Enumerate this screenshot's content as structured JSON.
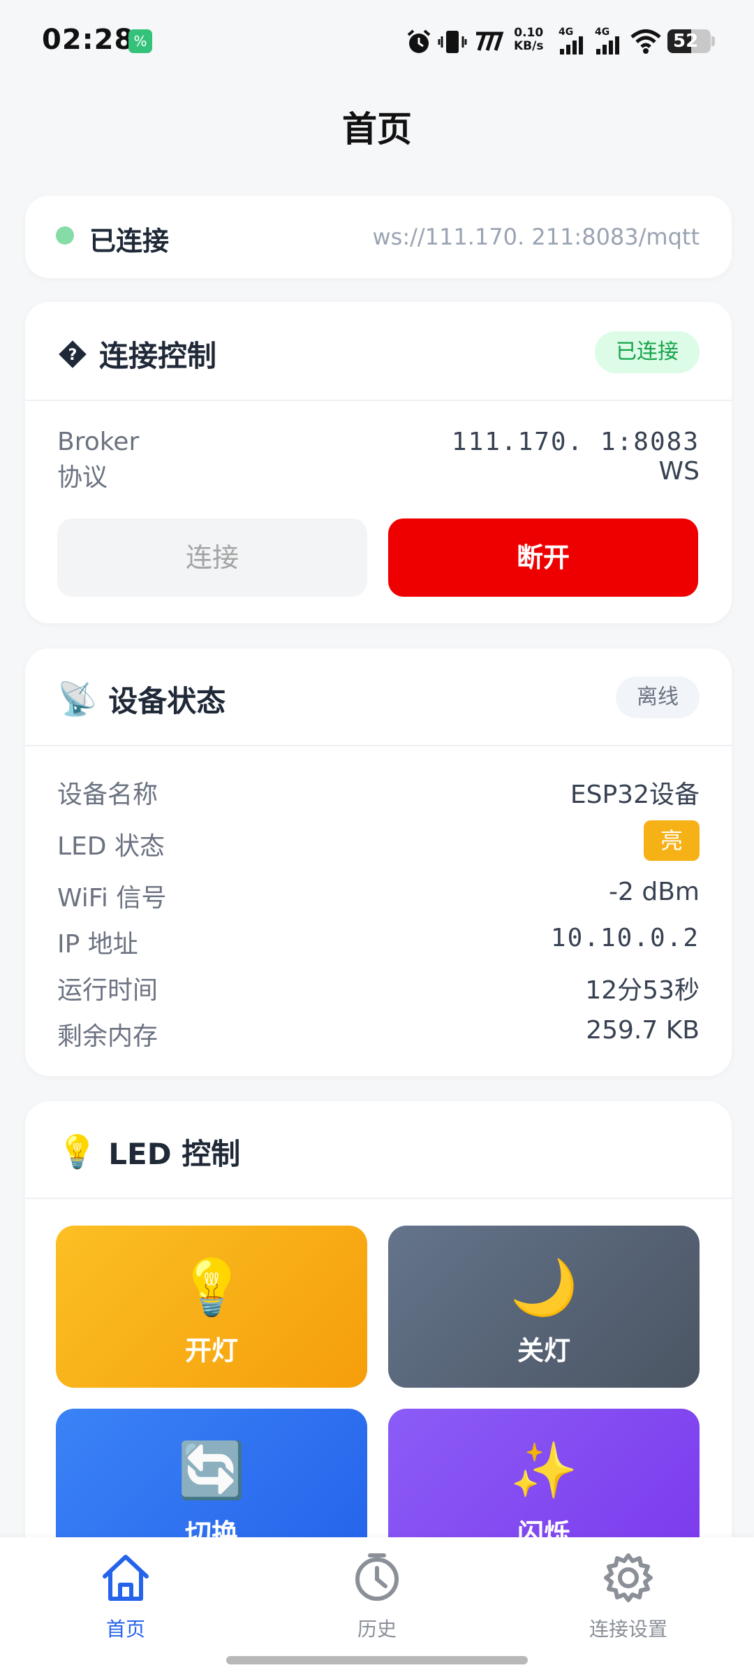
{
  "status_bar": {
    "time": "02:28",
    "net_speed_value": "0.10",
    "net_speed_unit": "KB/s",
    "network_type_1": "4G",
    "network_type_2": "4G",
    "battery_level": "52"
  },
  "header": {
    "title": "首页"
  },
  "connection_bar": {
    "status_label": "已连接",
    "url": "ws://111.170.  211:8083/mqtt",
    "status_color": "#86dca6"
  },
  "connection_control": {
    "title": "连接控制",
    "badge": "已连接",
    "broker_label": "Broker",
    "broker_value": "111.170.   1:8083",
    "protocol_label": "协议",
    "protocol_value": "WS",
    "connect_label": "连接",
    "disconnect_label": "断开",
    "disconnect_color": "#ee0000"
  },
  "device_status": {
    "title": "设备状态",
    "badge": "离线",
    "rows": [
      {
        "label": "设备名称",
        "value": "ESP32设备"
      },
      {
        "label": "LED 状态",
        "value": "亮"
      },
      {
        "label": "WiFi 信号",
        "value": "-2 dBm"
      },
      {
        "label": "IP 地址",
        "value": "10.10.0.2"
      },
      {
        "label": "运行时间",
        "value": "12分53秒"
      },
      {
        "label": "剩余内存",
        "value": "259.7 KB"
      }
    ]
  },
  "led_control": {
    "title": "LED 控制",
    "buttons": [
      {
        "label": "开灯",
        "icon": "bulb-icon"
      },
      {
        "label": "关灯",
        "icon": "moon-icon"
      },
      {
        "label": "切换",
        "icon": "refresh-icon"
      },
      {
        "label": "闪烁",
        "icon": "sparkles-icon"
      }
    ]
  },
  "bottom_nav": {
    "items": [
      {
        "label": "首页",
        "icon": "home-icon",
        "active": true
      },
      {
        "label": "历史",
        "icon": "clock-icon",
        "active": false
      },
      {
        "label": "连接设置",
        "icon": "gear-icon",
        "active": false
      }
    ],
    "active_color": "#2563eb"
  }
}
